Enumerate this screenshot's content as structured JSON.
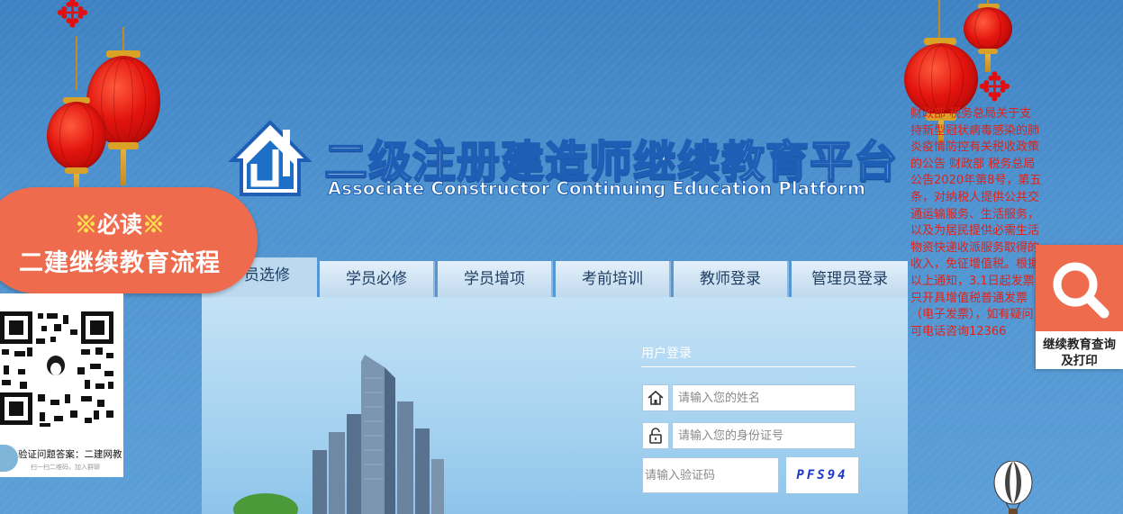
{
  "site": {
    "title": "二级注册建造师继续教育平台",
    "subtitle": "Associate Constructor Continuing Education Platform"
  },
  "must_read": {
    "line1_mark_left": "※",
    "line1_text": "必读",
    "line1_mark_right": "※",
    "line2": "二建继续教育流程"
  },
  "nav": {
    "tabs": [
      {
        "label": "学员选修",
        "active": true
      },
      {
        "label": "学员必修",
        "active": false
      },
      {
        "label": "学员增项",
        "active": false
      },
      {
        "label": "考前培训",
        "active": false
      },
      {
        "label": "教师登录",
        "active": false
      },
      {
        "label": "管理员登录",
        "active": false
      }
    ]
  },
  "login": {
    "title": "用户登录",
    "name_placeholder": "请输入您的姓名",
    "id_placeholder": "请输入您的身份证号",
    "captcha_placeholder": "请输入验证码",
    "captcha_code": "PFS94"
  },
  "notice": {
    "text": "财政部 税务总局关于支持新型冠状病毒感染的肺炎疫情防控有关税收政策的公告 财政部 税务总局公告2020年第8号，第五条，对纳税人提供公共交通运输服务、生活服务，以及为居民提供必需生活物资快递收派服务取得的收入，免征增值税。根据以上通知，3.1日起发票只开具增值税普通发票（电子发票），如有疑问可电话咨询12366"
  },
  "search_float": {
    "line1": "继续教育查询",
    "line2": "及打印"
  },
  "qr": {
    "caption": "验证问题答案：二建网教",
    "sub": "扫一扫二维码，加入群聊"
  },
  "icons": {
    "logo": "house-logo-icon",
    "name_field": "home-icon",
    "id_field": "lock-icon",
    "search": "search-icon"
  },
  "colors": {
    "accent_orange": "#ef6b4e",
    "notice_red": "#e0231a",
    "captcha_blue": "#1d38c8",
    "title_blue": "#1e5fb5"
  }
}
